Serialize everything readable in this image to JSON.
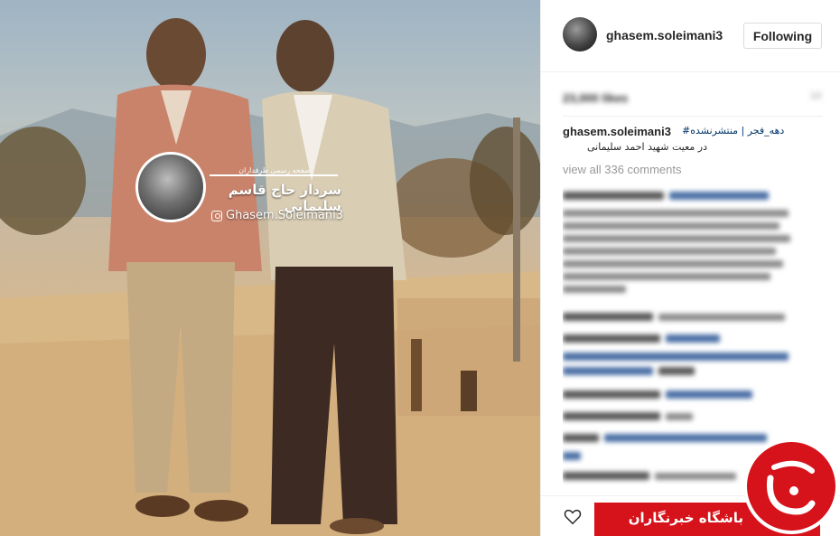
{
  "post": {
    "username": "ghasem.soleimani3",
    "follow_label": "Following",
    "likes_text": "23,000 likes",
    "time_text": "1d",
    "caption": {
      "username": "ghasem.soleimani3",
      "tags": "دهه_فجر | منتشرنشده#",
      "line2": "در معیت شهید احمد سلیمانی"
    },
    "view_all_comments": "view all 336 comments"
  },
  "photo_watermark": {
    "top_text": "صفحه رسمی طرفداران",
    "title": "سردار حاج قاسم سلیمانی",
    "handle": "Ghasem.Soleimani3"
  },
  "agency": {
    "banner_text": "باشگاه خبرنگاران",
    "logo_glyph": "ج"
  },
  "colors": {
    "link": "#003569",
    "agency_red": "#d6121a",
    "muted": "#999999"
  },
  "icons": [
    "heart-icon",
    "instagram-icon",
    "scroll-up-icon"
  ]
}
